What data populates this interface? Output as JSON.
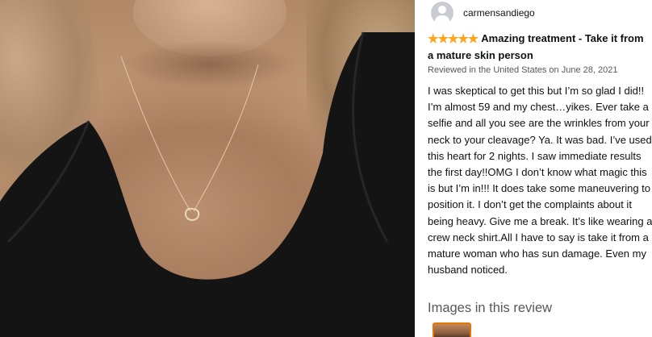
{
  "photo": {
    "alt_icon": "review-photo"
  },
  "review": {
    "reviewer_name": "carmensandiego",
    "rating_stars": "★★★★★",
    "rating_value": 5,
    "title": "Amazing treatment - Take it from a mature skin person",
    "meta": "Reviewed in the United States on June 28, 2021",
    "body": "I was skeptical to get this but I’m so glad I did!! I’m almost 59 and my chest…yikes. Ever take a selfie and all you see are the wrinkles from your neck to your cleavage? Ya. It was bad. I’ve used this heart for 2 nights. I saw immediate results the first day!!OMG I don’t know what magic this is but I’m in!!! It does take some maneuvering to position it. I don’t get the complaints about it being heavy. Give me a break. It’s like wearing a crew neck shirt.All I have to say is take it from a mature woman who has sun damage. Even my husband noticed.",
    "images_heading": "Images in this review"
  },
  "colors": {
    "star": "#ffa41c",
    "thumb_border": "#e77600",
    "meta_text": "#565959"
  }
}
